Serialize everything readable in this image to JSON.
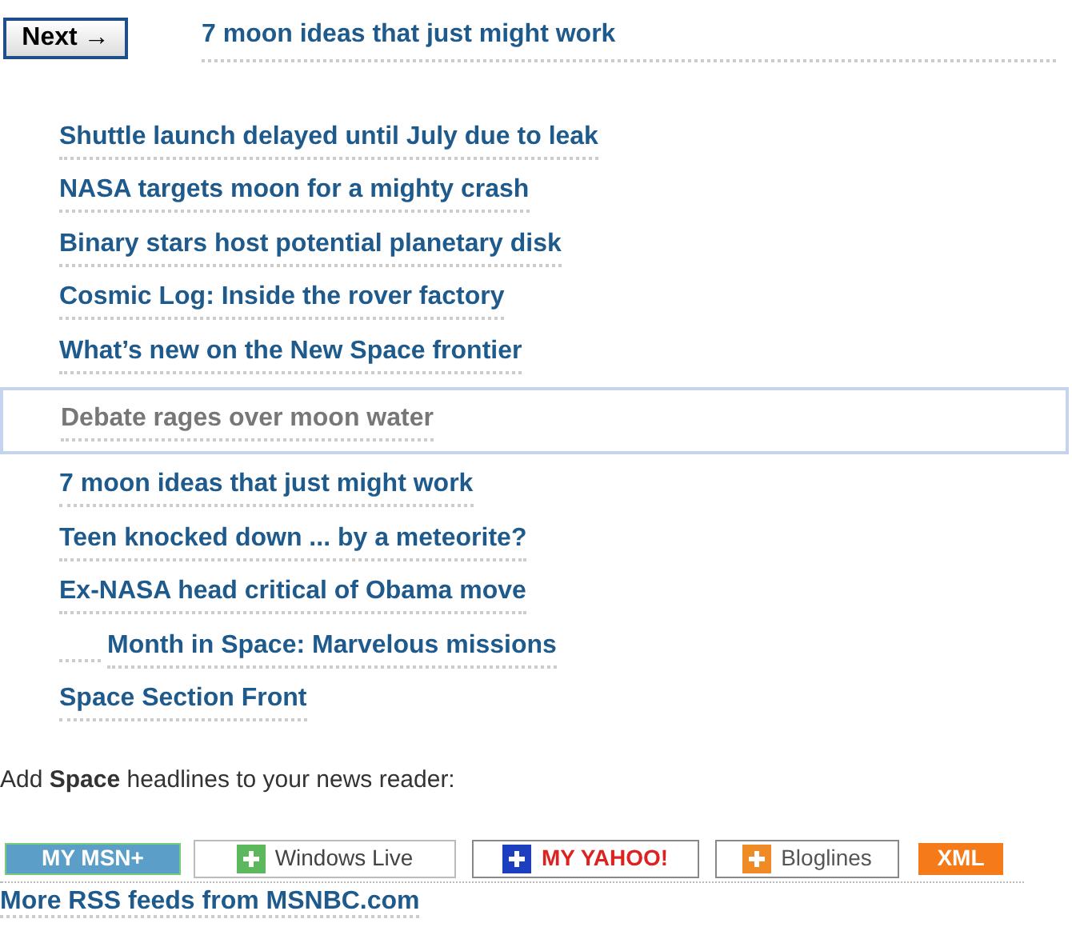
{
  "next_button": {
    "label": "Next",
    "arrow": "→"
  },
  "current_headline": "7 moon ideas that just might work",
  "headlines": [
    {
      "text": "Shuttle launch delayed until July due to leak",
      "selected": false,
      "has_icon": false
    },
    {
      "text": "NASA targets moon for a mighty crash",
      "selected": false,
      "has_icon": false
    },
    {
      "text": "Binary stars host potential planetary disk",
      "selected": false,
      "has_icon": false
    },
    {
      "text": "Cosmic Log: Inside the rover factory",
      "selected": false,
      "has_icon": false
    },
    {
      "text": "What’s new on the New Space frontier",
      "selected": false,
      "has_icon": false
    },
    {
      "text": "Debate rages over moon water",
      "selected": true,
      "has_icon": false
    },
    {
      "text": "7 moon ideas that just might work",
      "selected": false,
      "has_icon": false
    },
    {
      "text": "Teen knocked down ... by a meteorite?",
      "selected": false,
      "has_icon": false
    },
    {
      "text": "Ex-NASA head critical of Obama move",
      "selected": false,
      "has_icon": false
    },
    {
      "text": "Month in Space: Marvelous missions",
      "selected": false,
      "has_icon": true
    },
    {
      "text": "Space Section Front",
      "selected": false,
      "has_icon": false
    }
  ],
  "feed_prompt": "Add **Space** headlines to your news reader:",
  "feed_badges": [
    {
      "kind": "msn",
      "label": "MY MSN+"
    },
    {
      "kind": "windowslive",
      "label": "Windows Live"
    },
    {
      "kind": "yahoo",
      "label": "MY YAHOO!"
    },
    {
      "kind": "bloglines",
      "label": "Bloglines"
    },
    {
      "kind": "xml",
      "label": "XML"
    }
  ],
  "more_feeds_link": "More RSS feeds from MSNBC.com"
}
